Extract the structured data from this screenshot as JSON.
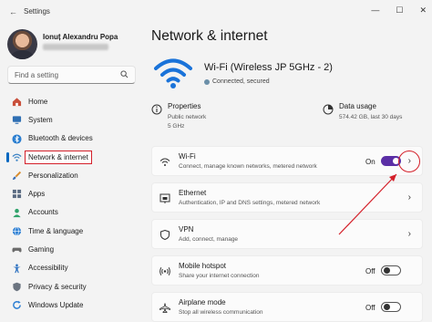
{
  "window": {
    "title": "Settings",
    "controls": [
      "—",
      "☐",
      "✕"
    ]
  },
  "user": {
    "name": "Ionuț Alexandru Popa"
  },
  "search": {
    "placeholder": "Find a setting"
  },
  "sidebar": {
    "items": [
      {
        "label": "Home",
        "icon": "home-icon",
        "color": "#c94f3a"
      },
      {
        "label": "System",
        "icon": "monitor-icon",
        "color": "#2f6fb3"
      },
      {
        "label": "Bluetooth & devices",
        "icon": "bluetooth-icon",
        "color": "#2a7ed0"
      },
      {
        "label": "Network & internet",
        "icon": "wifi-icon",
        "color": "#3b82c4",
        "active": true
      },
      {
        "label": "Personalization",
        "icon": "brush-icon",
        "color": "#d88c2d"
      },
      {
        "label": "Apps",
        "icon": "apps-icon",
        "color": "#5a6b82"
      },
      {
        "label": "Accounts",
        "icon": "person-icon",
        "color": "#2fa36b"
      },
      {
        "label": "Time & language",
        "icon": "globe-icon",
        "color": "#2d7fd3"
      },
      {
        "label": "Gaming",
        "icon": "controller-icon",
        "color": "#6b6b6b"
      },
      {
        "label": "Accessibility",
        "icon": "accessibility-icon",
        "color": "#2a6fc0"
      },
      {
        "label": "Privacy & security",
        "icon": "shield-icon",
        "color": "#6b7480"
      },
      {
        "label": "Windows Update",
        "icon": "update-icon",
        "color": "#2d7fd3"
      }
    ]
  },
  "main": {
    "title": "Network & internet",
    "connection": {
      "name": "Wi-Fi (Wireless JP 5GHz - 2)",
      "status": "Connected, secured"
    },
    "properties": {
      "title": "Properties",
      "line1": "Public network",
      "line2": "5 GHz"
    },
    "data_usage": {
      "title": "Data usage",
      "line1": "574.42 GB, last 30 days"
    },
    "cards": [
      {
        "title": "Wi-Fi",
        "desc": "Connect, manage known networks, metered network",
        "icon": "wifi-icon",
        "toggle": "On",
        "toggle_state": "on",
        "chevron": true
      },
      {
        "title": "Ethernet",
        "desc": "Authentication, IP and DNS settings, metered network",
        "icon": "ethernet-icon",
        "chevron": true
      },
      {
        "title": "VPN",
        "desc": "Add, connect, manage",
        "icon": "vpn-shield-icon",
        "chevron": true
      },
      {
        "title": "Mobile hotspot",
        "desc": "Share your internet connection",
        "icon": "hotspot-icon",
        "toggle": "Off",
        "toggle_state": "off",
        "chevron": false
      },
      {
        "title": "Airplane mode",
        "desc": "Stop all wireless communication",
        "icon": "airplane-icon",
        "toggle": "Off",
        "toggle_state": "off",
        "chevron": false
      }
    ]
  },
  "colors": {
    "accent": "#0067c0",
    "toggle_on": "#5b2fa6",
    "highlight": "#d4202a",
    "wifi_blue": "#1a73d9"
  }
}
